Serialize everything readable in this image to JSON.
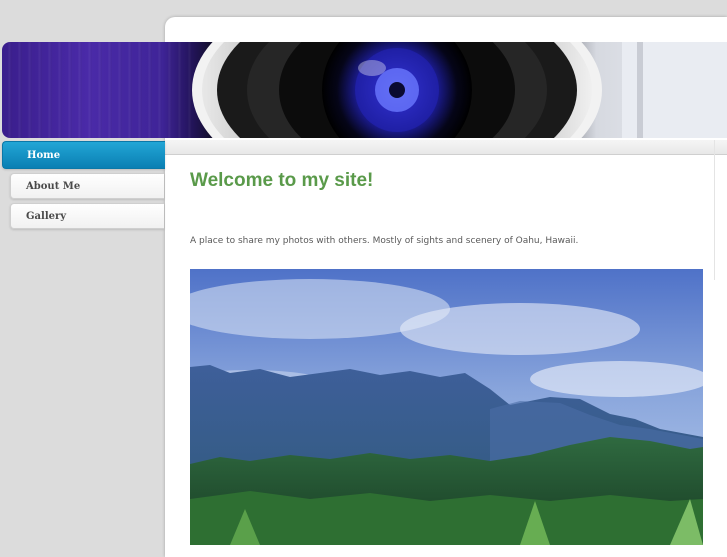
{
  "nav": {
    "items": [
      {
        "label": "Home",
        "active": true
      },
      {
        "label": "About Me",
        "active": false
      },
      {
        "label": "Gallery",
        "active": false
      }
    ]
  },
  "main": {
    "title": "Welcome to my site!",
    "intro": "A place to share my photos with others.  Mostly of sights and scenery of Oahu, Hawaii."
  },
  "colors": {
    "accent_title": "#5a9a4a",
    "nav_active": "#0a8fc4",
    "banner_purple": "#3a1e8c"
  }
}
